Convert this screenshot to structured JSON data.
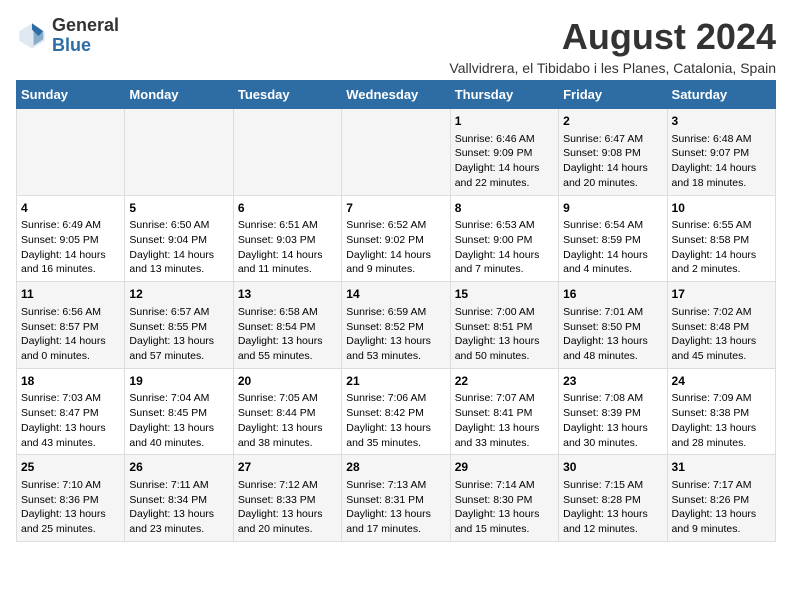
{
  "logo": {
    "general": "General",
    "blue": "Blue"
  },
  "title": "August 2024",
  "subtitle": "Vallvidrera, el Tibidabo i les Planes, Catalonia, Spain",
  "headers": [
    "Sunday",
    "Monday",
    "Tuesday",
    "Wednesday",
    "Thursday",
    "Friday",
    "Saturday"
  ],
  "weeks": [
    [
      {
        "day": "",
        "content": ""
      },
      {
        "day": "",
        "content": ""
      },
      {
        "day": "",
        "content": ""
      },
      {
        "day": "",
        "content": ""
      },
      {
        "day": "1",
        "content": "Sunrise: 6:46 AM\nSunset: 9:09 PM\nDaylight: 14 hours\nand 22 minutes."
      },
      {
        "day": "2",
        "content": "Sunrise: 6:47 AM\nSunset: 9:08 PM\nDaylight: 14 hours\nand 20 minutes."
      },
      {
        "day": "3",
        "content": "Sunrise: 6:48 AM\nSunset: 9:07 PM\nDaylight: 14 hours\nand 18 minutes."
      }
    ],
    [
      {
        "day": "4",
        "content": "Sunrise: 6:49 AM\nSunset: 9:05 PM\nDaylight: 14 hours\nand 16 minutes."
      },
      {
        "day": "5",
        "content": "Sunrise: 6:50 AM\nSunset: 9:04 PM\nDaylight: 14 hours\nand 13 minutes."
      },
      {
        "day": "6",
        "content": "Sunrise: 6:51 AM\nSunset: 9:03 PM\nDaylight: 14 hours\nand 11 minutes."
      },
      {
        "day": "7",
        "content": "Sunrise: 6:52 AM\nSunset: 9:02 PM\nDaylight: 14 hours\nand 9 minutes."
      },
      {
        "day": "8",
        "content": "Sunrise: 6:53 AM\nSunset: 9:00 PM\nDaylight: 14 hours\nand 7 minutes."
      },
      {
        "day": "9",
        "content": "Sunrise: 6:54 AM\nSunset: 8:59 PM\nDaylight: 14 hours\nand 4 minutes."
      },
      {
        "day": "10",
        "content": "Sunrise: 6:55 AM\nSunset: 8:58 PM\nDaylight: 14 hours\nand 2 minutes."
      }
    ],
    [
      {
        "day": "11",
        "content": "Sunrise: 6:56 AM\nSunset: 8:57 PM\nDaylight: 14 hours\nand 0 minutes."
      },
      {
        "day": "12",
        "content": "Sunrise: 6:57 AM\nSunset: 8:55 PM\nDaylight: 13 hours\nand 57 minutes."
      },
      {
        "day": "13",
        "content": "Sunrise: 6:58 AM\nSunset: 8:54 PM\nDaylight: 13 hours\nand 55 minutes."
      },
      {
        "day": "14",
        "content": "Sunrise: 6:59 AM\nSunset: 8:52 PM\nDaylight: 13 hours\nand 53 minutes."
      },
      {
        "day": "15",
        "content": "Sunrise: 7:00 AM\nSunset: 8:51 PM\nDaylight: 13 hours\nand 50 minutes."
      },
      {
        "day": "16",
        "content": "Sunrise: 7:01 AM\nSunset: 8:50 PM\nDaylight: 13 hours\nand 48 minutes."
      },
      {
        "day": "17",
        "content": "Sunrise: 7:02 AM\nSunset: 8:48 PM\nDaylight: 13 hours\nand 45 minutes."
      }
    ],
    [
      {
        "day": "18",
        "content": "Sunrise: 7:03 AM\nSunset: 8:47 PM\nDaylight: 13 hours\nand 43 minutes."
      },
      {
        "day": "19",
        "content": "Sunrise: 7:04 AM\nSunset: 8:45 PM\nDaylight: 13 hours\nand 40 minutes."
      },
      {
        "day": "20",
        "content": "Sunrise: 7:05 AM\nSunset: 8:44 PM\nDaylight: 13 hours\nand 38 minutes."
      },
      {
        "day": "21",
        "content": "Sunrise: 7:06 AM\nSunset: 8:42 PM\nDaylight: 13 hours\nand 35 minutes."
      },
      {
        "day": "22",
        "content": "Sunrise: 7:07 AM\nSunset: 8:41 PM\nDaylight: 13 hours\nand 33 minutes."
      },
      {
        "day": "23",
        "content": "Sunrise: 7:08 AM\nSunset: 8:39 PM\nDaylight: 13 hours\nand 30 minutes."
      },
      {
        "day": "24",
        "content": "Sunrise: 7:09 AM\nSunset: 8:38 PM\nDaylight: 13 hours\nand 28 minutes."
      }
    ],
    [
      {
        "day": "25",
        "content": "Sunrise: 7:10 AM\nSunset: 8:36 PM\nDaylight: 13 hours\nand 25 minutes."
      },
      {
        "day": "26",
        "content": "Sunrise: 7:11 AM\nSunset: 8:34 PM\nDaylight: 13 hours\nand 23 minutes."
      },
      {
        "day": "27",
        "content": "Sunrise: 7:12 AM\nSunset: 8:33 PM\nDaylight: 13 hours\nand 20 minutes."
      },
      {
        "day": "28",
        "content": "Sunrise: 7:13 AM\nSunset: 8:31 PM\nDaylight: 13 hours\nand 17 minutes."
      },
      {
        "day": "29",
        "content": "Sunrise: 7:14 AM\nSunset: 8:30 PM\nDaylight: 13 hours\nand 15 minutes."
      },
      {
        "day": "30",
        "content": "Sunrise: 7:15 AM\nSunset: 8:28 PM\nDaylight: 13 hours\nand 12 minutes."
      },
      {
        "day": "31",
        "content": "Sunrise: 7:17 AM\nSunset: 8:26 PM\nDaylight: 13 hours\nand 9 minutes."
      }
    ]
  ]
}
